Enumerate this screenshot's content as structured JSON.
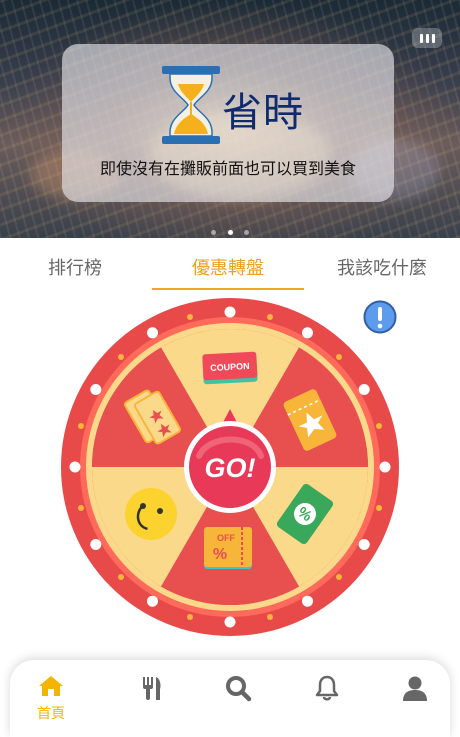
{
  "banner": {
    "title": "省時",
    "subtitle": "即使沒有在攤販前面也可以買到美食",
    "icon": "hourglass-icon",
    "slide_count": 3,
    "active_slide": 1
  },
  "tabs": [
    {
      "label": "排行榜"
    },
    {
      "label": "優惠轉盤"
    },
    {
      "label": "我該吃什麼"
    }
  ],
  "active_tab": 1,
  "wheel": {
    "center_label": "GO!",
    "coupon_label": "COUPON",
    "off_label": "OFF",
    "percent_label": "%",
    "segments": [
      "coupon-ticket-icon",
      "gold-ticket-icon",
      "percent-ticket-icon",
      "off-coupon-icon",
      "smiley-icon",
      "tickets-icon"
    ]
  },
  "bottom_nav": {
    "items": [
      {
        "icon": "home-icon",
        "label": "首頁"
      },
      {
        "icon": "cutlery-icon",
        "label": ""
      },
      {
        "icon": "search-icon",
        "label": ""
      },
      {
        "icon": "bell-icon",
        "label": ""
      },
      {
        "icon": "user-icon",
        "label": ""
      }
    ]
  },
  "colors": {
    "accent": "#f3a52b",
    "wheel_red": "#e84f4f",
    "wheel_cream": "#fbd98b",
    "nav_icon": "#666666",
    "nav_active": "#f5b400",
    "title_blue": "#102a70"
  }
}
